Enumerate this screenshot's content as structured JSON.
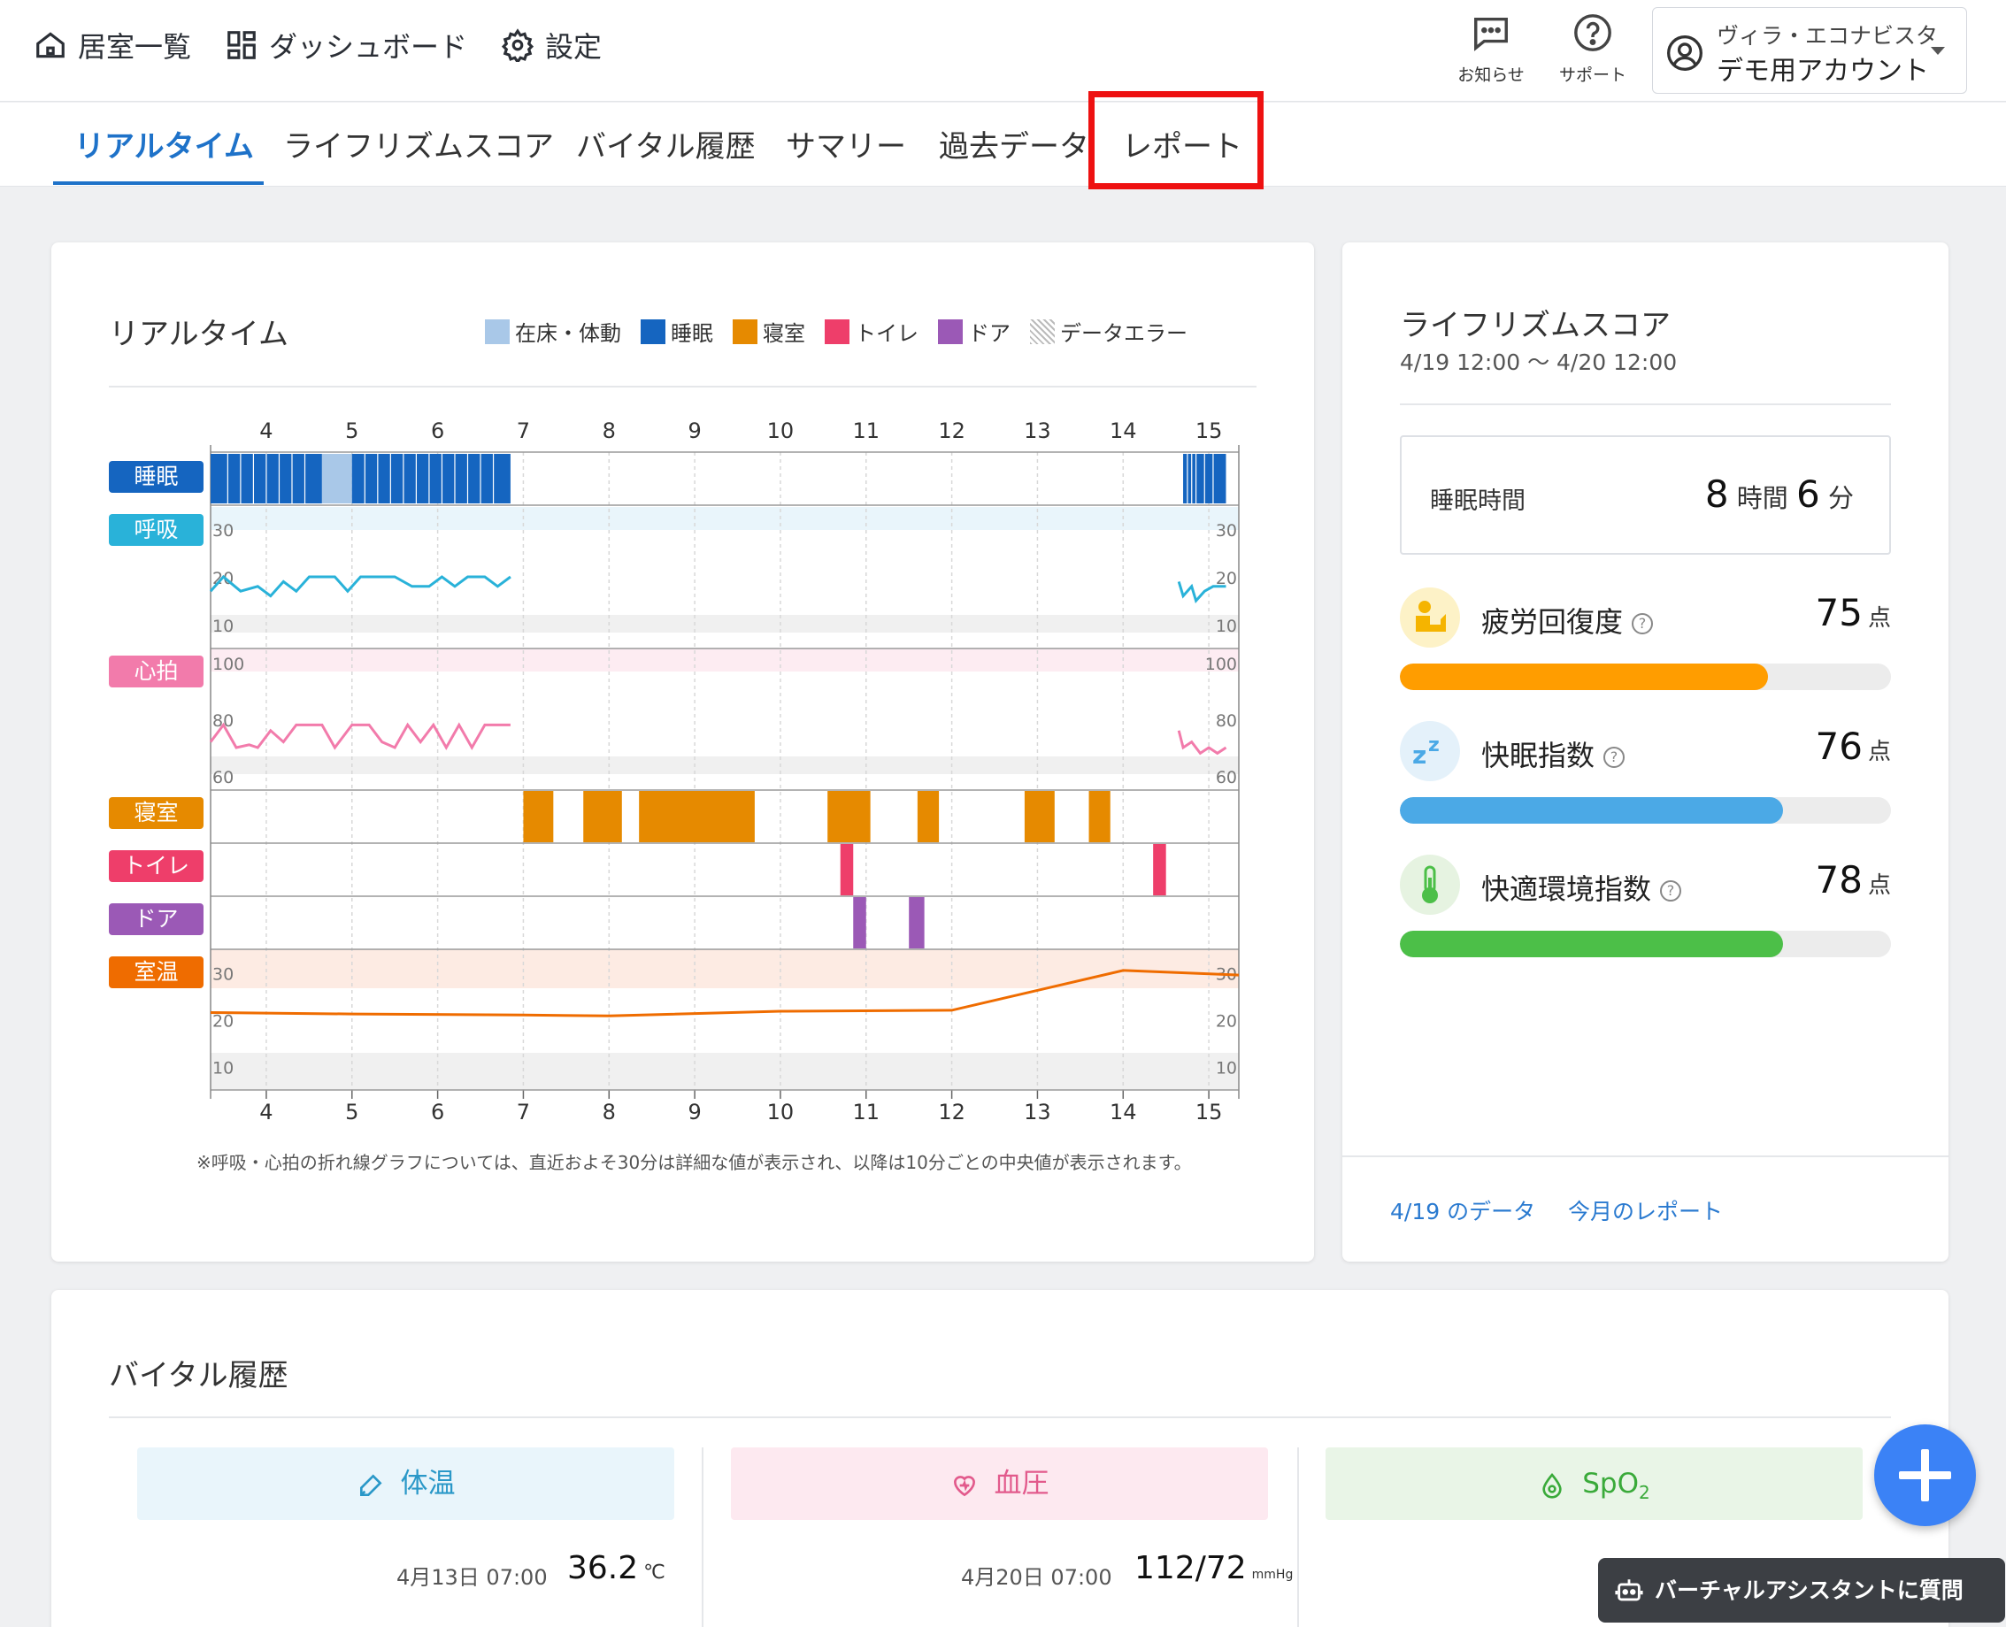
{
  "header": {
    "nav": [
      {
        "label": "居室一覧",
        "icon": "home-icon"
      },
      {
        "label": "ダッシュボード",
        "icon": "dashboard-icon"
      },
      {
        "label": "設定",
        "icon": "gear-icon"
      }
    ],
    "notifications_label": "お知らせ",
    "support_label": "サポート",
    "account": {
      "line1": "ヴィラ・エコナビスタ",
      "line2": "デモ用アカウント"
    }
  },
  "tabs": [
    {
      "label": "リアルタイム",
      "active": true
    },
    {
      "label": "ライフリズムスコア",
      "active": false
    },
    {
      "label": "バイタル履歴",
      "active": false
    },
    {
      "label": "サマリー",
      "active": false
    },
    {
      "label": "過去データ",
      "active": false
    },
    {
      "label": "レポート",
      "active": false,
      "highlighted": true
    }
  ],
  "realtime": {
    "title": "リアルタイム",
    "legend": [
      {
        "label": "在床・体動",
        "color": "#a9c8e8"
      },
      {
        "label": "睡眠",
        "color": "#1565c0"
      },
      {
        "label": "寝室",
        "color": "#e68a00"
      },
      {
        "label": "トイレ",
        "color": "#ee3e6a"
      },
      {
        "label": "ドア",
        "color": "#9b59b6"
      },
      {
        "label": "データエラー",
        "color": "#cccccc"
      }
    ],
    "row_labels": [
      {
        "label": "睡眠",
        "color": "#1565c0"
      },
      {
        "label": "呼吸",
        "color": "#29b2d9"
      },
      {
        "label": "心拍",
        "color": "#f27bab"
      },
      {
        "label": "寝室",
        "color": "#e68a00"
      },
      {
        "label": "トイレ",
        "color": "#ee3e6a"
      },
      {
        "label": "ドア",
        "color": "#9b59b6"
      },
      {
        "label": "室温",
        "color": "#ef6c00"
      }
    ],
    "note": "※呼吸・心拍の折れ線グラフについては、直近およそ30分は詳細な値が表示され、以降は10分ごとの中央値が表示されます。"
  },
  "chart_data": {
    "type": "timeline",
    "x_ticks": [
      "4",
      "5",
      "6",
      "7",
      "8",
      "9",
      "10",
      "11",
      "12",
      "13",
      "14",
      "15"
    ],
    "xlim": [
      3.35,
      15.35
    ],
    "sleep_segments": [
      {
        "start": 3.35,
        "end": 4.65,
        "state": "sleep"
      },
      {
        "start": 4.65,
        "end": 5.0,
        "state": "in-bed"
      },
      {
        "start": 5.0,
        "end": 6.85,
        "state": "sleep"
      },
      {
        "start": 14.7,
        "end": 15.2,
        "state": "sleep"
      }
    ],
    "respiration": {
      "ylim": [
        5,
        35
      ],
      "y_ticks": [
        10,
        20,
        30
      ],
      "points": [
        [
          3.35,
          17
        ],
        [
          3.5,
          20
        ],
        [
          3.7,
          17
        ],
        [
          3.9,
          18
        ],
        [
          4.05,
          16
        ],
        [
          4.2,
          19
        ],
        [
          4.35,
          17
        ],
        [
          4.5,
          20
        ],
        [
          4.65,
          20
        ],
        [
          4.8,
          20
        ],
        [
          4.95,
          17
        ],
        [
          5.1,
          20
        ],
        [
          5.3,
          20
        ],
        [
          5.5,
          20
        ],
        [
          5.7,
          18
        ],
        [
          5.9,
          18
        ],
        [
          6.05,
          20
        ],
        [
          6.2,
          18
        ],
        [
          6.35,
          20
        ],
        [
          6.55,
          20
        ],
        [
          6.7,
          18
        ],
        [
          6.85,
          20
        ]
      ],
      "points_recent": [
        [
          14.65,
          19
        ],
        [
          14.7,
          16
        ],
        [
          14.8,
          18
        ],
        [
          14.85,
          15
        ],
        [
          14.95,
          17
        ],
        [
          15.05,
          18
        ],
        [
          15.2,
          18
        ]
      ]
    },
    "heart_rate": {
      "ylim": [
        55,
        105
      ],
      "y_ticks": [
        60,
        80,
        100
      ],
      "points": [
        [
          3.35,
          72
        ],
        [
          3.5,
          78
        ],
        [
          3.65,
          70
        ],
        [
          3.8,
          71
        ],
        [
          3.9,
          70
        ],
        [
          4.05,
          76
        ],
        [
          4.2,
          72
        ],
        [
          4.35,
          78
        ],
        [
          4.5,
          78
        ],
        [
          4.65,
          78
        ],
        [
          4.8,
          70
        ],
        [
          5.0,
          78
        ],
        [
          5.2,
          78
        ],
        [
          5.35,
          72
        ],
        [
          5.5,
          70
        ],
        [
          5.65,
          78
        ],
        [
          5.8,
          72
        ],
        [
          5.95,
          78
        ],
        [
          6.1,
          70
        ],
        [
          6.25,
          78
        ],
        [
          6.4,
          70
        ],
        [
          6.55,
          78
        ],
        [
          6.7,
          78
        ],
        [
          6.85,
          78
        ]
      ],
      "points_recent": [
        [
          14.65,
          76
        ],
        [
          14.7,
          70
        ],
        [
          14.8,
          72
        ],
        [
          14.9,
          68
        ],
        [
          15.0,
          70
        ],
        [
          15.1,
          68
        ],
        [
          15.2,
          70
        ]
      ]
    },
    "bedroom": [
      [
        7.0,
        7.35
      ],
      [
        7.7,
        8.15
      ],
      [
        8.35,
        9.7
      ],
      [
        10.55,
        11.05
      ],
      [
        11.6,
        11.85
      ],
      [
        12.85,
        13.2
      ],
      [
        13.6,
        13.85
      ]
    ],
    "toilet": [
      [
        10.7,
        10.85
      ],
      [
        14.35,
        14.5
      ]
    ],
    "door": [
      [
        10.85,
        11.0
      ],
      [
        11.5,
        11.68
      ]
    ],
    "room_temp": {
      "ylim": [
        5,
        35
      ],
      "y_ticks": [
        10,
        20,
        30
      ],
      "points": [
        [
          3.35,
          21.5
        ],
        [
          5.0,
          21.2
        ],
        [
          7.0,
          21.0
        ],
        [
          8.0,
          20.8
        ],
        [
          10.0,
          21.8
        ],
        [
          12.0,
          22.0
        ],
        [
          14.0,
          30.5
        ],
        [
          15.35,
          29.5
        ]
      ]
    }
  },
  "lifescore": {
    "title": "ライフリズムスコア",
    "date_range": "4/19 12:00 〜 4/20 12:00",
    "sleep_time_label": "睡眠時間",
    "sleep_hours": "8",
    "hours_unit": "時間",
    "sleep_minutes": "6",
    "minutes_unit": "分",
    "scores": [
      {
        "label": "疲労回復度",
        "value": "75",
        "unit": "点",
        "fraction": 0.75,
        "color": "#ff9d00",
        "icon": "fatigue-recovery-icon",
        "icon_bg": "#fdf2c7"
      },
      {
        "label": "快眠指数",
        "value": "76",
        "unit": "点",
        "fraction": 0.78,
        "color": "#4ba9e6",
        "icon": "sleep-zz-icon",
        "icon_bg": "#e4f1fa"
      },
      {
        "label": "快適環境指数",
        "value": "78",
        "unit": "点",
        "fraction": 0.78,
        "color": "#4cbf48",
        "icon": "thermometer-icon",
        "icon_bg": "#e6f3e1"
      }
    ],
    "links": {
      "day_data": "4/19 のデータ",
      "month_report": "今月のレポート"
    }
  },
  "vitals": {
    "title": "バイタル履歴",
    "tiles": [
      {
        "label": "体温",
        "date": "4月13日 07:00",
        "value": "36.2",
        "unit": "℃",
        "bg": "#e9f5fb",
        "color": "#2a98c8",
        "icon": "thermometer-pen-icon"
      },
      {
        "label": "血圧",
        "date": "4月20日 07:00",
        "value": "112/72",
        "unit": "mmHg",
        "bg": "#fde9f0",
        "color": "#e25a8c",
        "icon": "heart-pulse-icon"
      },
      {
        "label": "SpO",
        "sub": "2",
        "date": "",
        "value": "",
        "unit": "",
        "bg": "#e9f5e7",
        "color": "#3aaa3a",
        "icon": "water-drop-icon"
      }
    ]
  },
  "assistant_label": "バーチャルアシスタントに質問"
}
